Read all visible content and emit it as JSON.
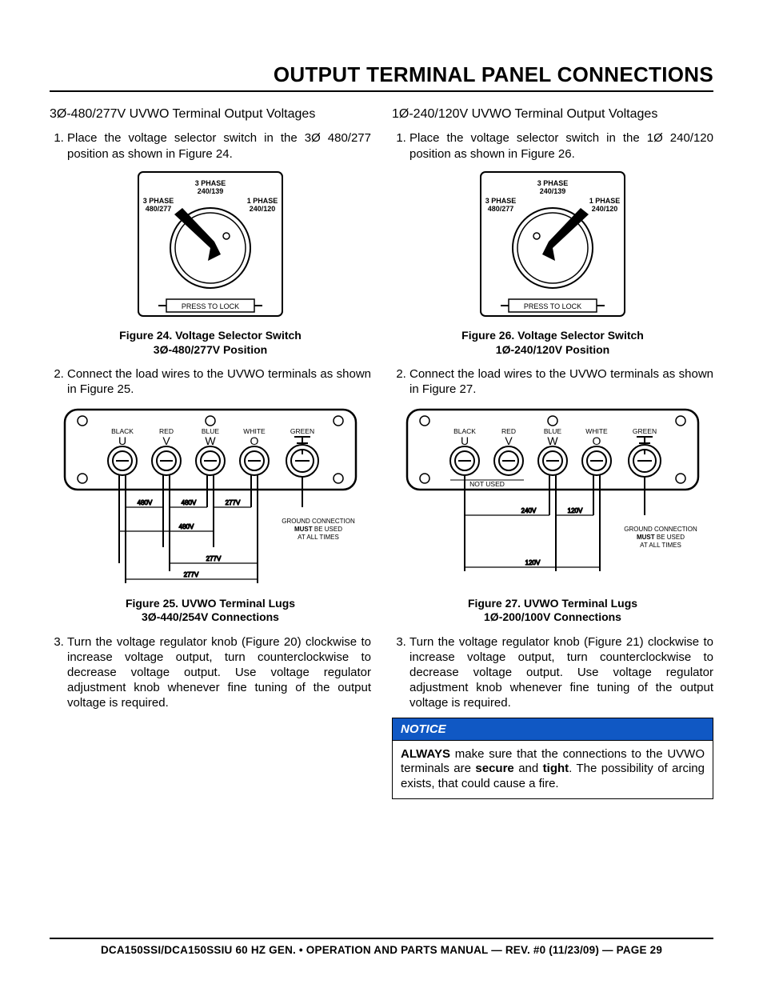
{
  "page_title": "OUTPUT TERMINAL PANEL CONNECTIONS",
  "switch_labels": {
    "top": "3 PHASE",
    "top2": "240/139",
    "left": "3 PHASE",
    "left2": "480/277",
    "right": "1 PHASE",
    "right2": "240/120",
    "button": "PRESS TO LOCK"
  },
  "terminal_labels": {
    "colors": [
      "BLACK",
      "RED",
      "BLUE",
      "WHITE",
      "GREEN"
    ],
    "letters": [
      "U",
      "V",
      "W",
      "O"
    ],
    "ground": "GROUND CONNECTION",
    "must": "MUST",
    "beused": " BE USED",
    "atall": "AT ALL TIMES",
    "not_used": "NOT USED"
  },
  "left": {
    "subhead": "3Ø-480/277V UVWO Terminal Output Voltages",
    "step1": "Place the voltage selector switch in the 3Ø 480/277 position as shown in Figure 24.",
    "fig24_l1": "Figure 24. Voltage Selector Switch",
    "fig24_l2": "3Ø-480/277V Position",
    "step2": "Connect the load wires to the UVWO terminals as shown in Figure 25.",
    "fig25_l1": "Figure 25. UVWO Terminal Lugs",
    "fig25_l2": "3Ø-440/254V Connections",
    "step3": "Turn the voltage regulator knob (Figure 20) clockwise to increase voltage output, turn counterclockwise to decrease voltage output. Use voltage regulator adjustment knob whenever fine tuning of the output voltage is required.",
    "volts": {
      "v480": "480V",
      "v277": "277V"
    }
  },
  "right": {
    "subhead": "1Ø-240/120V UVWO Terminal Output Voltages",
    "step1": "Place the voltage selector switch in the 1Ø 240/120 position as shown in Figure 26.",
    "fig26_l1": "Figure 26. Voltage Selector Switch",
    "fig26_l2": "1Ø-240/120V Position",
    "step2": "Connect the load wires to the UVWO terminals as shown in Figure 27.",
    "fig27_l1": "Figure 27. UVWO Terminal Lugs",
    "fig27_l2": "1Ø-200/100V Connections",
    "step3": "Turn the voltage regulator knob (Figure 21) clockwise to increase voltage output, turn counterclockwise to decrease voltage output. Use voltage regulator adjustment knob whenever fine tuning of the output voltage is required.",
    "volts": {
      "v240": "240V",
      "v120": "120V"
    }
  },
  "notice": {
    "head": "NOTICE",
    "always": "ALWAYS",
    "text1": " make sure that the connections to the UVWO terminals are ",
    "secure": "secure",
    "and": " and ",
    "tight": "tight",
    "text2": ". The possibility of arcing exists, that could cause a fire."
  },
  "footer": "DCA150SSI/DCA150SSIU 60 HZ GEN. • OPERATION AND PARTS MANUAL — REV. #0 (11/23/09) — PAGE 29"
}
